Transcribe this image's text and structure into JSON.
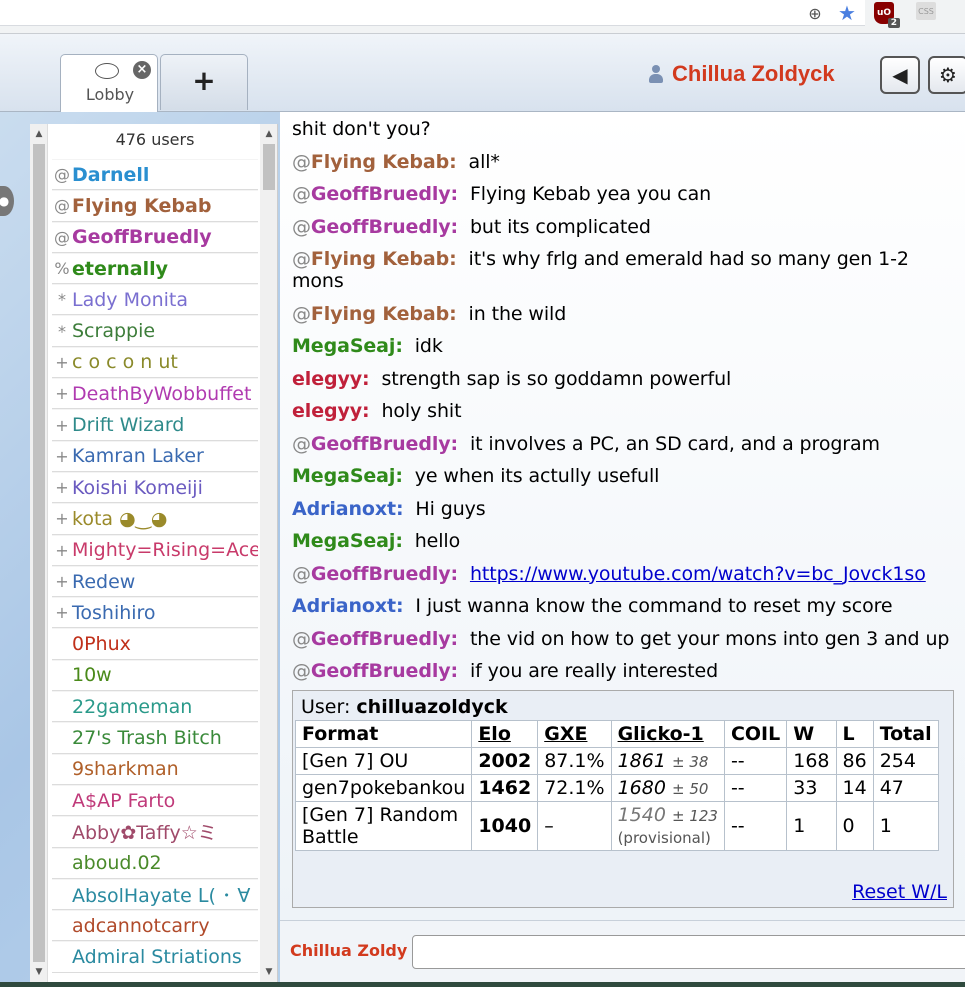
{
  "header": {
    "tabs": [
      {
        "label": "Lobby"
      },
      {
        "label": "+"
      }
    ],
    "username": "Chillua Zoldyck"
  },
  "userlist": {
    "count_label": "476 users",
    "users": [
      {
        "rank": "@",
        "name": "Darnell",
        "color": "#2a8fd0",
        "bold": true
      },
      {
        "rank": "@",
        "name": "Flying Kebab",
        "color": "#a2613c",
        "bold": true
      },
      {
        "rank": "@",
        "name": "GeoffBruedly",
        "color": "#a73aa0",
        "bold": true
      },
      {
        "rank": "%",
        "name": "eternally",
        "color": "#2f8a1a",
        "bold": true
      },
      {
        "rank": "*",
        "name": "Lady Monita",
        "color": "#7a6fd0",
        "bold": false
      },
      {
        "rank": "*",
        "name": "Scrappie",
        "color": "#3d7d3a",
        "bold": false
      },
      {
        "rank": "+",
        "name": "c o c o n ut",
        "color": "#8a8a2a",
        "bold": false
      },
      {
        "rank": "+",
        "name": "DeathByWobbuffet",
        "color": "#b03ab0",
        "bold": false
      },
      {
        "rank": "+",
        "name": "Drift Wizard",
        "color": "#2e8a8a",
        "bold": false
      },
      {
        "rank": "+",
        "name": "Kamran Laker",
        "color": "#3a6ab0",
        "bold": false
      },
      {
        "rank": "+",
        "name": "Koishi Komeiji",
        "color": "#6a5ac0",
        "bold": false
      },
      {
        "rank": "+",
        "name": "kota ◕‿◕",
        "color": "#9a8a2a",
        "bold": false
      },
      {
        "rank": "+",
        "name": "Mighty=Rising=Ace",
        "color": "#c83a6a",
        "bold": false
      },
      {
        "rank": "+",
        "name": "Redew",
        "color": "#3a6ab0",
        "bold": false
      },
      {
        "rank": "+",
        "name": "Toshihiro",
        "color": "#3a6ab0",
        "bold": false
      },
      {
        "rank": "",
        "name": "0Phux",
        "color": "#c0301a",
        "bold": false
      },
      {
        "rank": "",
        "name": "10w",
        "color": "#4a8a1a",
        "bold": false
      },
      {
        "rank": "",
        "name": "22gameman",
        "color": "#2a9a8a",
        "bold": false
      },
      {
        "rank": "",
        "name": "27's Trash Bitch",
        "color": "#3a8a3a",
        "bold": false
      },
      {
        "rank": "",
        "name": "9sharkman",
        "color": "#b0602a",
        "bold": false
      },
      {
        "rank": "",
        "name": "A$AP Farto",
        "color": "#c03a7a",
        "bold": false
      },
      {
        "rank": "",
        "name": "Abby✿Taffy☆ミ",
        "color": "#a04a6a",
        "bold": false
      },
      {
        "rank": "",
        "name": "aboud.02",
        "color": "#4a8a2a",
        "bold": false
      },
      {
        "rank": "",
        "name": "AbsolHayate ᒪ( ･ ∀",
        "color": "#2a8aa0",
        "bold": false
      },
      {
        "rank": "",
        "name": "adcannotcarry",
        "color": "#b04a2a",
        "bold": false
      },
      {
        "rank": "",
        "name": "Admiral Striations",
        "color": "#2a8aa0",
        "bold": false
      }
    ]
  },
  "chat": {
    "messages": [
      {
        "at": "",
        "user": "",
        "color": "#000",
        "text": "shit don't you?"
      },
      {
        "at": "@",
        "user": "Flying Kebab:",
        "color": "#a2613c",
        "text": "all*"
      },
      {
        "at": "@",
        "user": "GeoffBruedly:",
        "color": "#a73aa0",
        "text": "Flying Kebab yea you can"
      },
      {
        "at": "@",
        "user": "GeoffBruedly:",
        "color": "#a73aa0",
        "text": "but its complicated"
      },
      {
        "at": "@",
        "user": "Flying Kebab:",
        "color": "#a2613c",
        "text": "it's why frlg and emerald had so many gen 1-2 mons"
      },
      {
        "at": "@",
        "user": "Flying Kebab:",
        "color": "#a2613c",
        "text": "in the wild"
      },
      {
        "at": "",
        "user": "MegaSeaj:",
        "color": "#2f8a1a",
        "text": "idk"
      },
      {
        "at": "",
        "user": "elegyy:",
        "color": "#c0203a",
        "text": "strength sap is so goddamn powerful"
      },
      {
        "at": "",
        "user": "elegyy:",
        "color": "#c0203a",
        "text": "holy shit"
      },
      {
        "at": "@",
        "user": "GeoffBruedly:",
        "color": "#a73aa0",
        "text": "it involves a PC, an SD card, and a program"
      },
      {
        "at": "",
        "user": "MegaSeaj:",
        "color": "#2f8a1a",
        "text": "ye when its actully usefull"
      },
      {
        "at": "",
        "user": "Adrianoxt:",
        "color": "#3a64c8",
        "text": "Hi guys"
      },
      {
        "at": "",
        "user": "MegaSeaj:",
        "color": "#2f8a1a",
        "text": "hello"
      },
      {
        "at": "@",
        "user": "GeoffBruedly:",
        "color": "#a73aa0",
        "text": "https://www.youtube.com/watch?v=bc_Jovck1so",
        "link": true
      },
      {
        "at": "",
        "user": "Adrianoxt:",
        "color": "#3a64c8",
        "text": "I just wanna know the command to reset my score"
      },
      {
        "at": "@",
        "user": "GeoffBruedly:",
        "color": "#a73aa0",
        "text": "the vid on how to get your mons into gen 3 and up"
      },
      {
        "at": "@",
        "user": "GeoffBruedly:",
        "color": "#a73aa0",
        "text": "if you are really interested"
      }
    ]
  },
  "ranking": {
    "user_label": "User:",
    "user": "chilluazoldyck",
    "headers": [
      "Format",
      "Elo",
      "GXE",
      "Glicko-1",
      "COIL",
      "W",
      "L",
      "Total"
    ],
    "rows": [
      {
        "format": "[Gen 7] OU",
        "elo": "2002",
        "gxe": "87.1%",
        "glicko": "1861",
        "glicko_dev": "± 38",
        "coil": "--",
        "w": "168",
        "l": "86",
        "total": "254"
      },
      {
        "format": "gen7pokebankou",
        "elo": "1462",
        "gxe": "72.1%",
        "glicko": "1680",
        "glicko_dev": "± 50",
        "coil": "--",
        "w": "33",
        "l": "14",
        "total": "47"
      },
      {
        "format": "[Gen 7] Random Battle",
        "elo": "1040",
        "gxe": "–",
        "glicko": "1540",
        "glicko_dev": "± 123",
        "glicko_note": "(provisional)",
        "coil": "--",
        "w": "1",
        "l": "0",
        "total": "1"
      }
    ],
    "reset_label": "Reset W/L"
  },
  "input": {
    "who": "Chillua Zoldy",
    "value": ""
  }
}
